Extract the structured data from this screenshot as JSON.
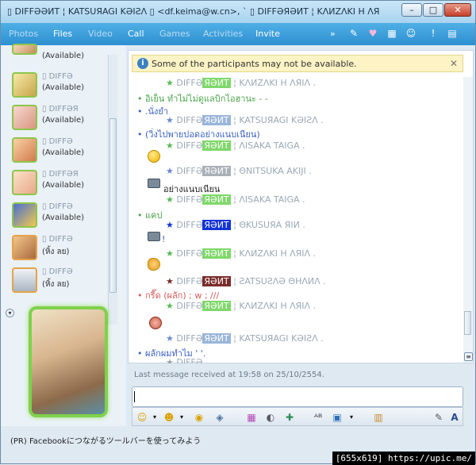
{
  "window": {
    "title": "▯ DIFFƏƏИT ¦ KATSUЯAGI KƏIƧΛ ▯ <df.keima@w.cn>, `          ▯ DIFFƏЯƏИT ¦ KΛИZΛKI H ΛЯIΛ ...",
    "min": "–",
    "max": "□",
    "close": "✕"
  },
  "menu": {
    "items": [
      "Photos",
      "Files",
      "Video",
      "Call",
      "Games",
      "Activities",
      "Invite"
    ],
    "more": "»"
  },
  "contacts": [
    {
      "name": "",
      "status": "(Available)"
    },
    {
      "name": "▯ DIFFƏ",
      "status": "(Available)"
    },
    {
      "name": "▯ DIFFƏЯ",
      "status": "(Available)"
    },
    {
      "name": "▯ DIFFƏ",
      "status": "(Available)"
    },
    {
      "name": "▯ DIFFƏЯ",
      "status": "(Available)"
    },
    {
      "name": "▯ DIFFƏ",
      "status": "(Available)"
    },
    {
      "name": "▯ DIFFƏ",
      "status": "(หิ้ง ลย)"
    },
    {
      "name": "▯ DIFFƏ",
      "status": "(หิ้ง ลย)"
    }
  ],
  "infobar": {
    "text": "Some of the participants may not be available.",
    "icon": "i",
    "close": "✕"
  },
  "messages": [
    {
      "type": "sender",
      "star": "★",
      "name": "DIFFƏ",
      "tag": "ЯƏИT",
      "rest": " ¦ KΛИZΛKI H ΛЯIΛ .",
      "tagcolor": "#7fd86a"
    },
    {
      "type": "text",
      "bullet": "•",
      "text": "อิเย็น ทำไม่ไม่ดูแลบิกไอฮานะ - -",
      "color": "green"
    },
    {
      "type": "text",
      "bullet": "•",
      "text": ".นั่งยำ",
      "color": "blue"
    },
    {
      "type": "text",
      "bullet": "•",
      "text": "(วิ่งไปพายปอดอย่างแนบเนียน)",
      "color": "blue"
    },
    {
      "type": "sender",
      "star": "★",
      "name": "DIFFƏ",
      "tag": "ЯƏИT",
      "rest": " ¦ KATSUЯAGI KƏIƧΛ .",
      "tagcolor": "#9ab5da"
    },
    {
      "type": "emoji"
    },
    {
      "type": "sender",
      "star": "★",
      "name": "DIFFƏ",
      "tag": "ЯƏИT",
      "rest": " ¦ ΛISAKA TAIGA .",
      "tagcolor": "#7fd86a"
    },
    {
      "type": "text",
      "bullet": "•",
      "text": "แคป",
      "color": "green"
    },
    {
      "type": "sender",
      "star": "★",
      "name": "DIFFƏ",
      "tag": "ЯƏИT",
      "rest": " ¦ ΘKUSUЯA ЯIИ .",
      "tagcolor": "#1233d8"
    },
    {
      "type": "sender",
      "star": "★",
      "name": "DIFFƏ",
      "tag": "ЯƏИT",
      "rest": " ¦ KΛИZΛKI H ΛЯIΛ .",
      "tagcolor": "#7fd86a"
    },
    {
      "type": "sender",
      "star": "★",
      "name": "DIFFƏ",
      "tag": "ЯƏИT",
      "rest": " ¦ ƧATSUƧΛƏ ΘHΛИΛ .",
      "tagcolor": "#7a2c2c"
    },
    {
      "type": "text",
      "bullet": "•",
      "text": "กรี๊ด (ผลัก) ; w ; ///",
      "color": "red"
    },
    {
      "type": "sender",
      "star": "★",
      "name": "DIFFƏ",
      "tag": "ЯƏИT",
      "rest": " ¦ KΛИZΛKI H ΛЯIΛ .",
      "tagcolor": "#7fd86a"
    },
    {
      "type": "sender",
      "star": "★",
      "name": "DIFFƏ",
      "tag": "ЯƏИT",
      "rest": " ¦ KATSUЯAGI KƏIƧΛ .",
      "tagcolor": "#9ab5da"
    },
    {
      "type": "text",
      "bullet": "•",
      "text": "ผลักผมทำไม ' '.",
      "color": "blue"
    }
  ],
  "extra": {
    "sender2_rest": " ¦ ΘNITSUKA AKIJI .",
    "line_camera": "อย่างแนบเนียน",
    "camera_bang": "!",
    "bottom_sender": "★ DIFFƏ"
  },
  "status": {
    "last_message": "Last message received at 19:58 on 25/10/2554.",
    "ad": "(PR) Facebookにつながるツールバーを使ってみよう",
    "credit": "[655x619] https://upic.me/"
  },
  "colors": {
    "accent": "#2d8fd0",
    "bubble_green": "#7fd14c"
  }
}
